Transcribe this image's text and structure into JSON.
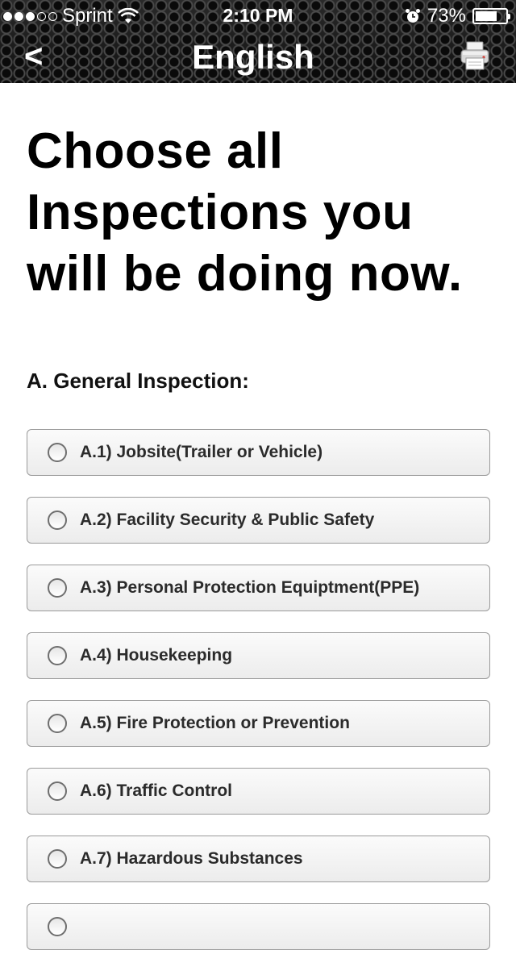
{
  "status_bar": {
    "carrier": "Sprint",
    "time": "2:10 PM",
    "battery_percent": "73%",
    "battery_level": 0.73,
    "signal_bars_filled": 3,
    "signal_bars_total": 5
  },
  "nav": {
    "back_label": "<",
    "title": "English",
    "print_icon": "printer-icon"
  },
  "page": {
    "title": "Choose all Inspections you will be doing now.",
    "section_title": "A. General Inspection:"
  },
  "options": [
    {
      "label": "A.1) Jobsite(Trailer or Vehicle)"
    },
    {
      "label": "A.2) Facility Security & Public Safety"
    },
    {
      "label": "A.3) Personal Protection Equiptment(PPE)"
    },
    {
      "label": "A.4) Housekeeping"
    },
    {
      "label": "A.5) Fire Protection or Prevention"
    },
    {
      "label": "A.6) Traffic Control"
    },
    {
      "label": "A.7) Hazardous Substances"
    },
    {
      "label": ""
    }
  ]
}
